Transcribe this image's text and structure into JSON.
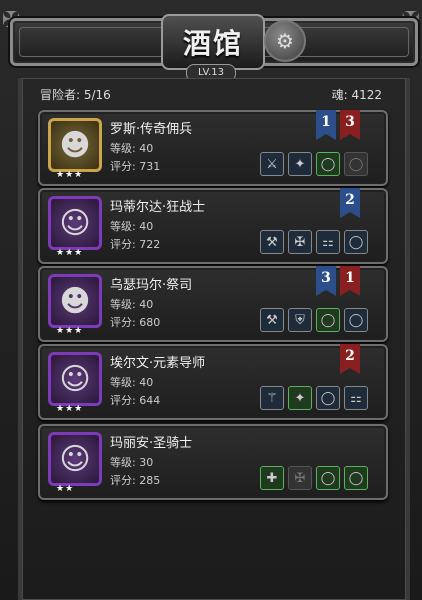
{
  "header": {
    "title": "酒馆",
    "level": "LV.13"
  },
  "stats": {
    "adventurers": "冒险者: 5/16",
    "soul": "魂: 4122"
  },
  "heroes": [
    {
      "name": "罗斯·传奇佣兵",
      "level": "等级: 40",
      "score": "评分: 731",
      "stars": "★★★",
      "frame": "gold",
      "flags": [
        {
          "n": "1",
          "c": "blue"
        },
        {
          "n": "3",
          "c": "red"
        }
      ],
      "slots": [
        {
          "icon": "sword-icon",
          "kind": "blue",
          "g": "⚔"
        },
        {
          "icon": "potion-icon",
          "kind": "blue",
          "g": "✦"
        },
        {
          "icon": "ring-icon",
          "kind": "green",
          "g": "◯"
        },
        {
          "icon": "ring-icon",
          "kind": "gray",
          "g": "◯"
        }
      ]
    },
    {
      "name": "玛蒂尔达·狂战士",
      "level": "等级: 40",
      "score": "评分: 722",
      "stars": "★★★",
      "frame": "purple",
      "flags": [
        {
          "n": "2",
          "c": "blue"
        }
      ],
      "slots": [
        {
          "icon": "axe-icon",
          "kind": "blue",
          "g": "⚒"
        },
        {
          "icon": "armor-icon",
          "kind": "blue",
          "g": "✠"
        },
        {
          "icon": "scroll-icon",
          "kind": "blue",
          "g": "⚏"
        },
        {
          "icon": "ring-icon",
          "kind": "blue",
          "g": "◯"
        }
      ]
    },
    {
      "name": "乌瑟玛尔·祭司",
      "level": "等级: 40",
      "score": "评分: 680",
      "stars": "★★★",
      "frame": "purple",
      "flags": [
        {
          "n": "3",
          "c": "blue"
        },
        {
          "n": "1",
          "c": "red"
        }
      ],
      "slots": [
        {
          "icon": "hammer-icon",
          "kind": "blue",
          "g": "⚒"
        },
        {
          "icon": "shield-icon",
          "kind": "blue",
          "g": "⛨"
        },
        {
          "icon": "ring-icon",
          "kind": "green",
          "g": "◯"
        },
        {
          "icon": "ring-icon",
          "kind": "blue",
          "g": "◯"
        }
      ]
    },
    {
      "name": "埃尔文·元素导师",
      "level": "等级: 40",
      "score": "评分: 644",
      "stars": "★★★",
      "frame": "purple",
      "flags": [
        {
          "n": "2",
          "c": "red"
        }
      ],
      "slots": [
        {
          "icon": "staff-icon",
          "kind": "blue",
          "g": "⚚"
        },
        {
          "icon": "cloak-icon",
          "kind": "green",
          "g": "✦"
        },
        {
          "icon": "ring-icon",
          "kind": "blue",
          "g": "◯"
        },
        {
          "icon": "scroll-icon",
          "kind": "blue",
          "g": "⚏"
        }
      ]
    },
    {
      "name": "玛丽安·圣骑士",
      "level": "等级: 30",
      "score": "评分: 285",
      "stars": "★★",
      "frame": "purple",
      "flags": [],
      "slots": [
        {
          "icon": "add-weapon-icon",
          "kind": "green",
          "g": "✚"
        },
        {
          "icon": "armor-empty-icon",
          "kind": "gray",
          "g": "✠"
        },
        {
          "icon": "ring-icon",
          "kind": "green",
          "g": "◯"
        },
        {
          "icon": "ring-icon",
          "kind": "green",
          "g": "◯"
        }
      ]
    }
  ]
}
